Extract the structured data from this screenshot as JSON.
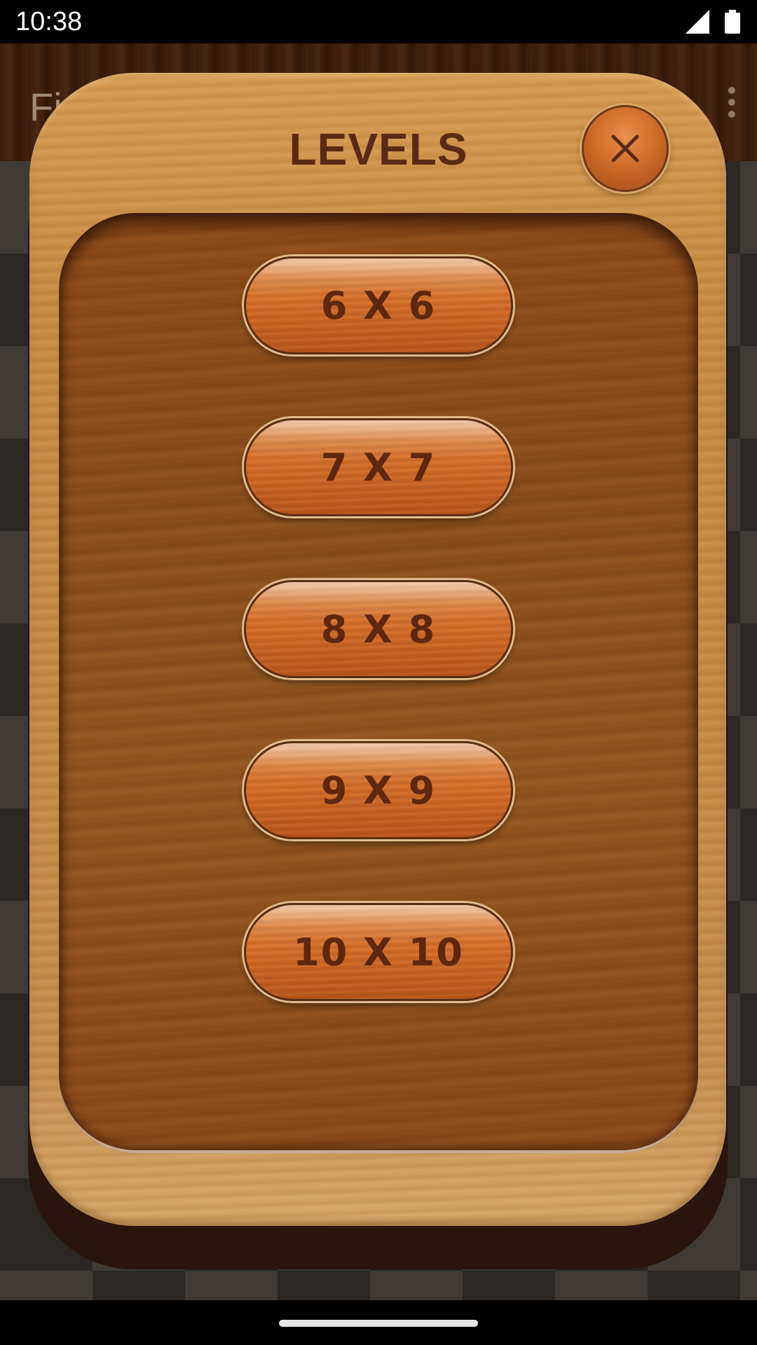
{
  "status_bar": {
    "time": "10:38"
  },
  "app_bar": {
    "title": "Fin"
  },
  "dialog": {
    "title": "LEVELS",
    "levels": [
      "6 X 6",
      "7 X 7",
      "8 X 8",
      "9 X 9",
      "10 X 10"
    ]
  },
  "colors": {
    "title_text": "#5a2a14",
    "button_orange": "#d56f2a",
    "wood_frame": "#c88c43",
    "wood_panel": "#8d4a18"
  },
  "icons": [
    "cellular-signal-icon",
    "battery-icon",
    "overflow-menu-icon",
    "close-icon"
  ]
}
